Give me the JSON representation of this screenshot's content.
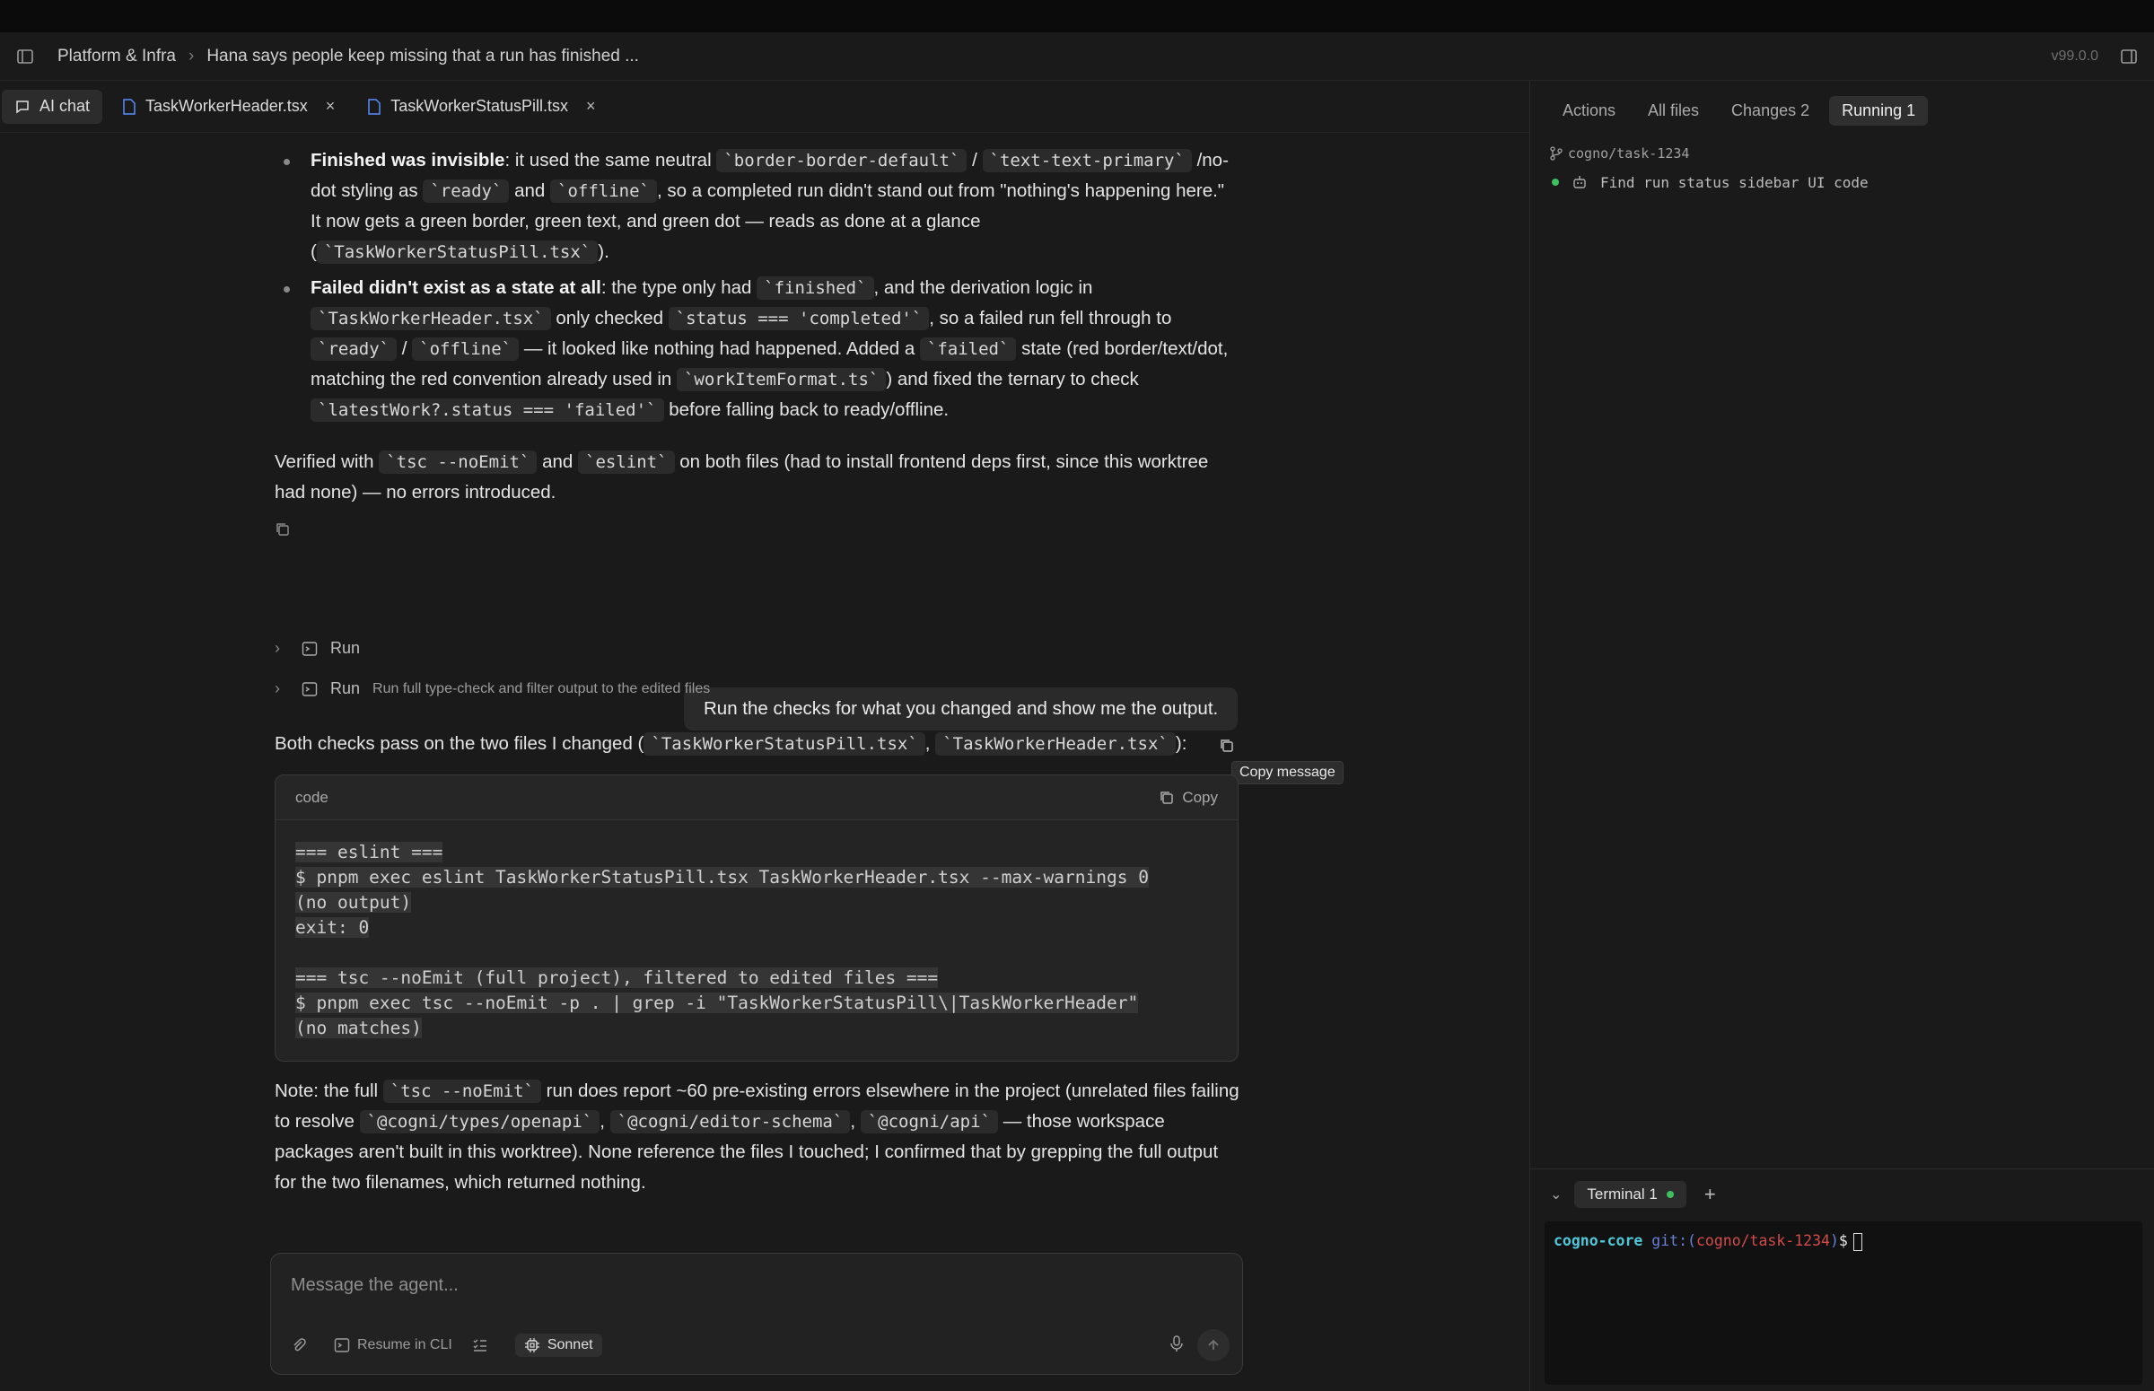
{
  "header": {
    "breadcrumb_root": "Platform & Infra",
    "breadcrumb_current": "Hana says people keep missing that a run has finished ...",
    "version": "v99.0.0"
  },
  "tabs": [
    {
      "label": "AI chat",
      "active": true
    },
    {
      "label": "TaskWorkerHeader.tsx",
      "active": false
    },
    {
      "label": "TaskWorkerStatusPill.tsx",
      "active": false
    }
  ],
  "chat": {
    "bullet1": {
      "bold": "Finished was invisible",
      "t1": ": it used the same neutral ",
      "c1": "`border-border-default`",
      "t2": " / ",
      "c2": "`text-text-primary`",
      "t3": " /no-dot styling as ",
      "c3": "`ready`",
      "t4": " and ",
      "c4": "`offline`",
      "t5": ", so a completed run didn't stand out from \"nothing's happening here.\" It now gets a green border, green text, and green dot — reads as done at a glance (",
      "c5": "`TaskWorkerStatusPill.tsx`",
      "t6": ")."
    },
    "bullet2": {
      "bold": "Failed didn't exist as a state at all",
      "t1": ": the type only had ",
      "c1": "`finished`",
      "t2": ", and the derivation logic in ",
      "c2": "`TaskWorkerHeader.tsx`",
      "t3": " only checked ",
      "c3": "`status === 'completed'`",
      "t4": ", so a failed run fell through to ",
      "c4": "`ready`",
      "t5": " / ",
      "c5": "`offline`",
      "t6": " — it looked like nothing had happened. Added a ",
      "c6": "`failed`",
      "t7": " state (red border/text/dot, matching the red convention already used in ",
      "c7": "`workItemFormat.ts`",
      "t8": ") and fixed the ternary to check ",
      "c8": "`latestWork?.status === 'failed'`",
      "t9": " before falling back to ready/offline."
    },
    "verified": {
      "t1": "Verified with ",
      "c1": "`tsc --noEmit`",
      "t2": " and ",
      "c2": "`eslint`",
      "t3": " on both files (had to install frontend deps first, since this worktree had none) — no errors introduced."
    },
    "user_message": "Run the checks for what you changed and show me the output.",
    "tooltip": "Copy message",
    "run1_label": "Run",
    "run2_label": "Run",
    "run2_desc": "Run full type-check and filter output to the edited files",
    "summary": {
      "t1": "Both checks pass on the two files I changed (",
      "c1": "`TaskWorkerStatusPill.tsx`",
      "t2": ", ",
      "c2": "`TaskWorkerHeader.tsx`",
      "t3": "):"
    },
    "code": {
      "lang": "code",
      "copy_label": "Copy",
      "lines": [
        "=== eslint ===",
        "$ pnpm exec eslint TaskWorkerStatusPill.tsx TaskWorkerHeader.tsx --max-warnings 0",
        "(no output)",
        "exit: 0",
        "",
        "=== tsc --noEmit (full project), filtered to edited files ===",
        "$ pnpm exec tsc --noEmit -p . | grep -i \"TaskWorkerStatusPill\\|TaskWorkerHeader\"",
        "(no matches)"
      ]
    },
    "note": {
      "t1": "Note: the full ",
      "c1": "`tsc --noEmit`",
      "t2": " run does report ~60 pre-existing errors elsewhere in the project (unrelated files failing to resolve ",
      "c2": "`@cogni/types/openapi`",
      "t3": ", ",
      "c3": "`@cogni/editor-schema`",
      "t4": ", ",
      "c4": "`@cogni/api`",
      "t5": " — those workspace packages aren't built in this worktree). None reference the files I touched; I confirmed that by grepping the full output for the two filenames, which returned nothing."
    }
  },
  "composer": {
    "placeholder": "Message the agent...",
    "resume_label": "Resume in CLI",
    "model_label": "Sonnet"
  },
  "sidebar": {
    "tabs": [
      {
        "label": "Actions",
        "active": false
      },
      {
        "label": "All files",
        "active": false
      },
      {
        "label": "Changes 2",
        "active": false
      },
      {
        "label": "Running 1",
        "active": true
      }
    ],
    "branch": "cogno/task-1234",
    "task": "Find run status sidebar UI code"
  },
  "terminal": {
    "tab_label": "Terminal 1",
    "host": "cogno-core",
    "git_prefix": "git:(",
    "branch": "cogno/task-1234",
    "git_suffix": ")",
    "prompt": "$"
  },
  "colors": {
    "accent_green": "#3fbf5f",
    "background": "#1a1a1a"
  }
}
